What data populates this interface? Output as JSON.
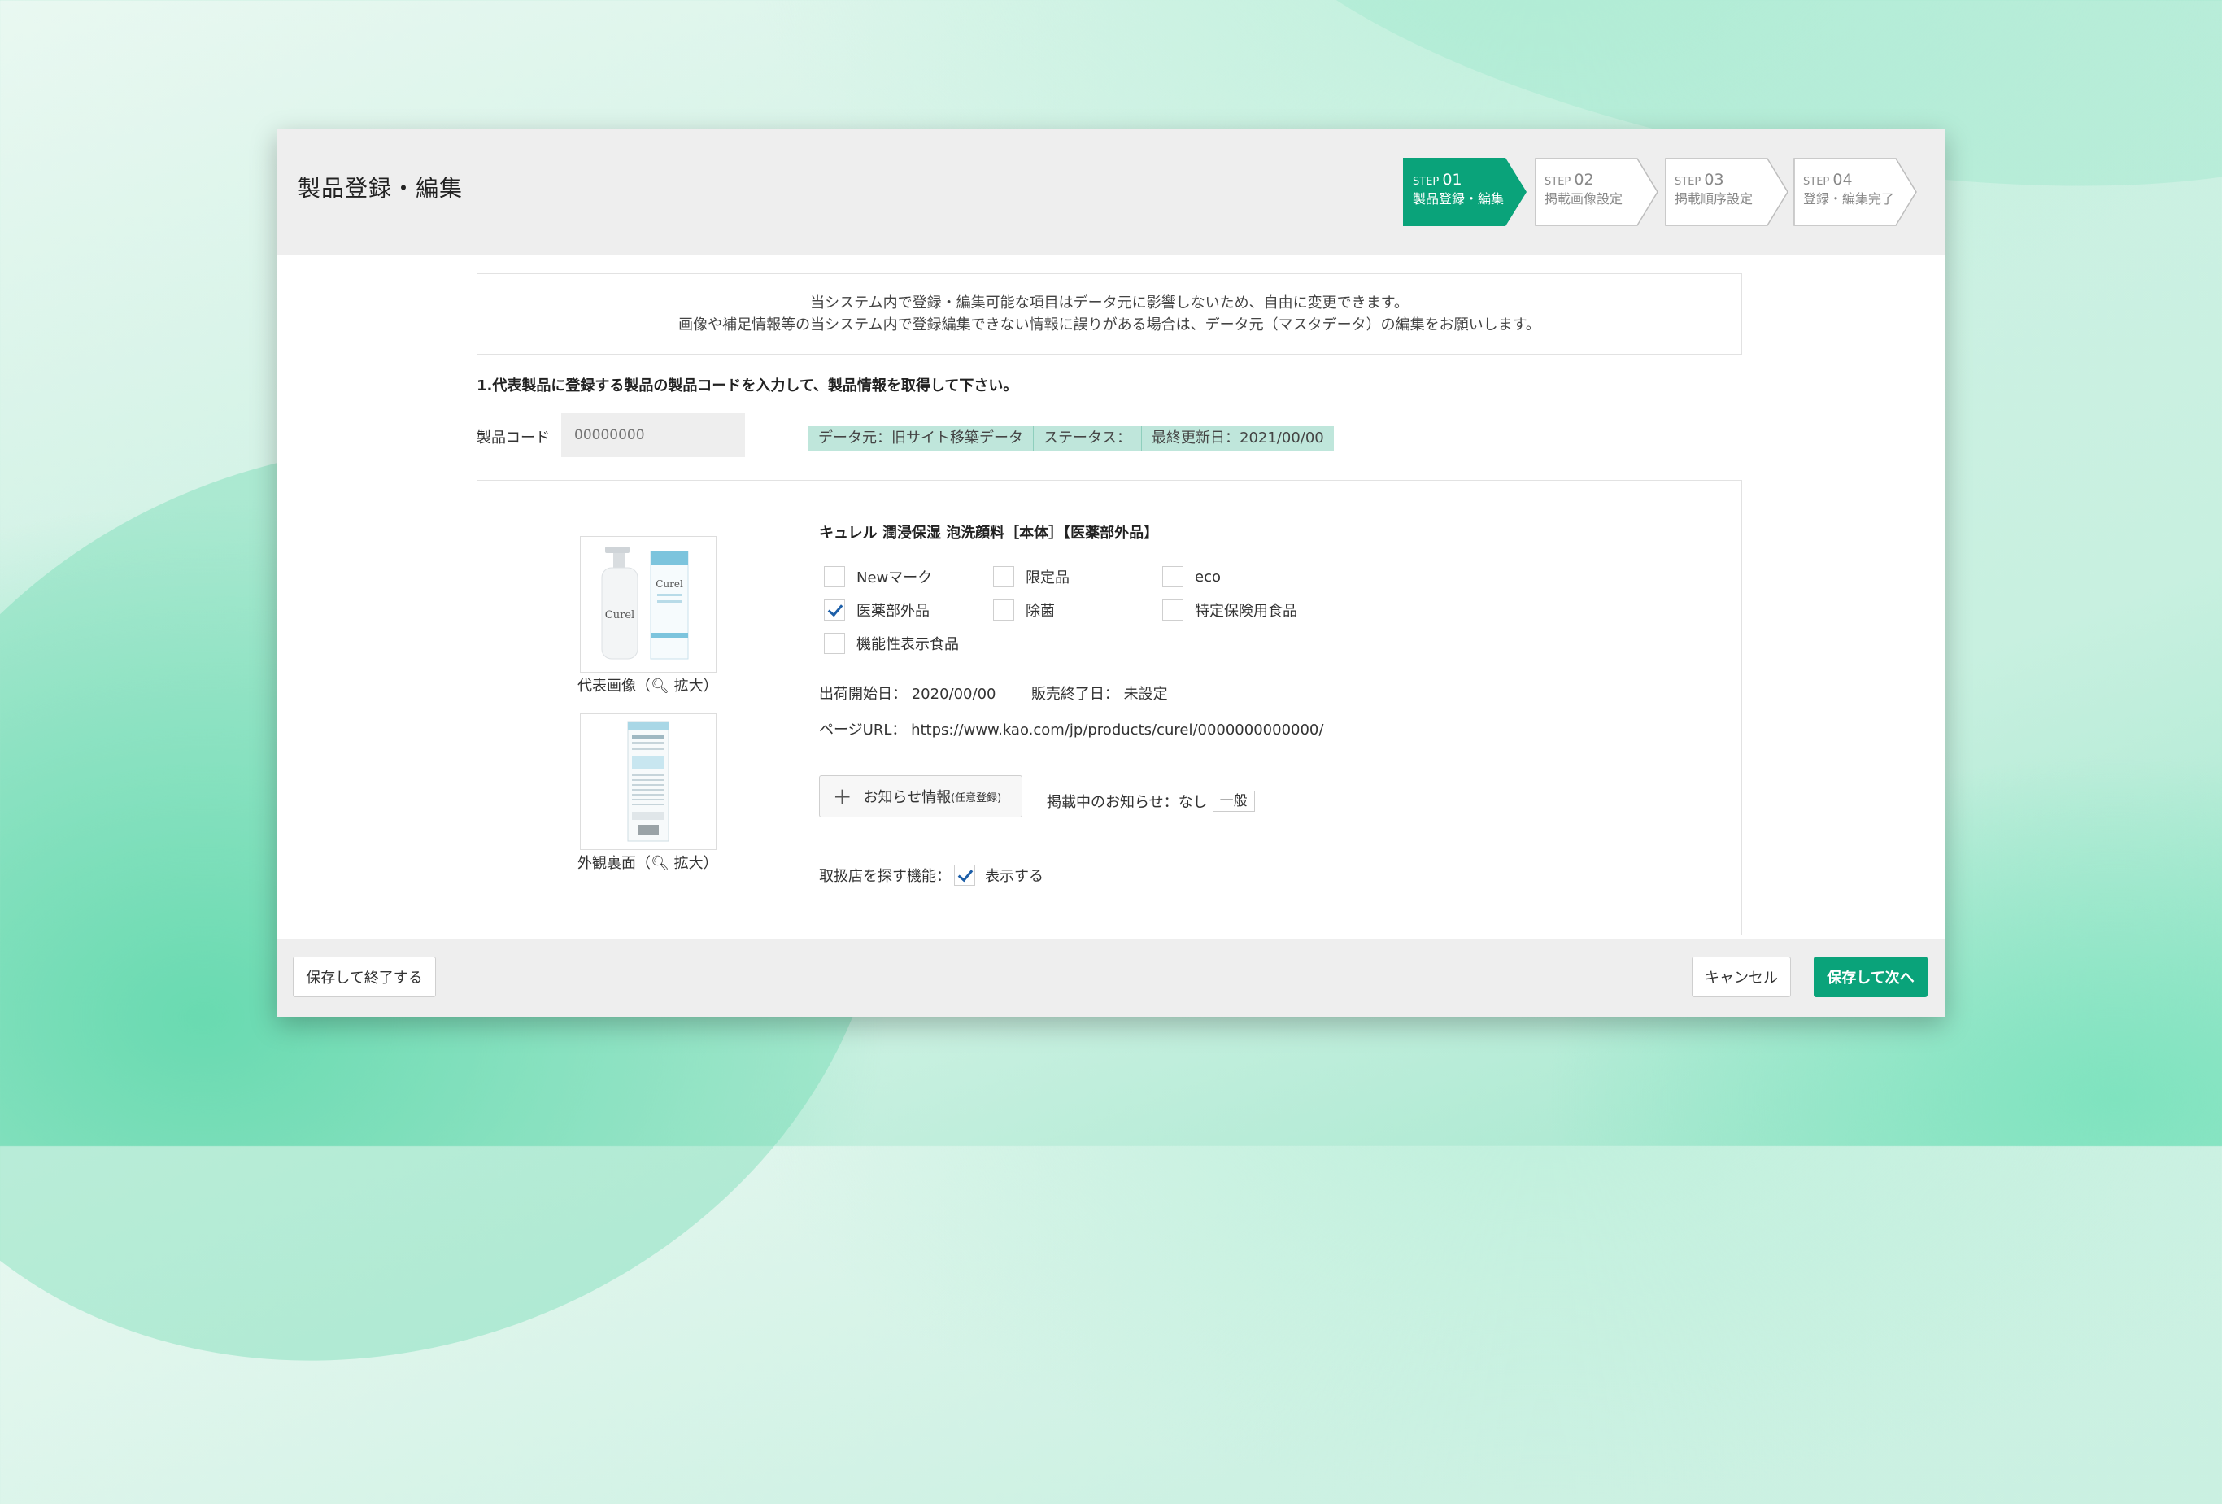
{
  "header": {
    "title": "製品登録・編集"
  },
  "steps": [
    {
      "prefix": "STEP",
      "num": "01",
      "label": "製品登録・編集",
      "active": true
    },
    {
      "prefix": "STEP",
      "num": "02",
      "label": "掲載画像設定",
      "active": false
    },
    {
      "prefix": "STEP",
      "num": "03",
      "label": "掲載順序設定",
      "active": false
    },
    {
      "prefix": "STEP",
      "num": "04",
      "label": "登録・編集完了",
      "active": false
    }
  ],
  "notice": {
    "line1": "当システム内で登録・編集可能な項目はデータ元に影響しないため、自由に変更できます。",
    "line2": "画像や補足情報等の当システム内で登録編集できない情報に誤りがある場合は、データ元（マスタデータ）の編集をお願いします。"
  },
  "section_title": "1.代表製品に登録する製品の製品コードを入力して、製品情報を取得して下さい。",
  "code": {
    "label": "製品コード",
    "placeholder": "00000000"
  },
  "meta": {
    "source": "データ元：旧サイト移築データ",
    "status": "ステータス：",
    "updated": "最終更新日：2021/00/00"
  },
  "product": {
    "name": "キュレル 潤浸保湿 泡洗顔料［本体］【医薬部外品】",
    "main_image_caption_pre": "代表画像（",
    "main_image_caption_post": "拡大）",
    "back_image_caption_pre": "外観裏面（",
    "back_image_caption_post": "拡大）",
    "brand_text": "Curel",
    "checkboxes": [
      {
        "label": "Newマーク",
        "checked": false
      },
      {
        "label": "限定品",
        "checked": false
      },
      {
        "label": "eco",
        "checked": false
      },
      {
        "label": "医薬部外品",
        "checked": true
      },
      {
        "label": "除菌",
        "checked": false
      },
      {
        "label": "特定保険用食品",
        "checked": false
      },
      {
        "label": "機能性表示食品",
        "checked": false
      }
    ],
    "ship_start": "出荷開始日： 2020/00/00",
    "sale_end": "販売終了日： 未設定",
    "page_url": "ページURL： https://www.kao.com/jp/products/curel/0000000000000/",
    "news_button": "お知らせ情報",
    "news_button_note": "(任意登録)",
    "news_status": "掲載中のお知らせ：なし",
    "news_tag": "一般",
    "store_label": "取扱店を探す機能：",
    "store_value": "表示する",
    "store_checked": true
  },
  "footer": {
    "save_exit": "保存して終了する",
    "cancel": "キャンセル",
    "save_next": "保存して次へ"
  },
  "colors": {
    "accent": "#0aa37a",
    "meta_bg": "#bfe6db",
    "check": "#1d5fa8"
  }
}
